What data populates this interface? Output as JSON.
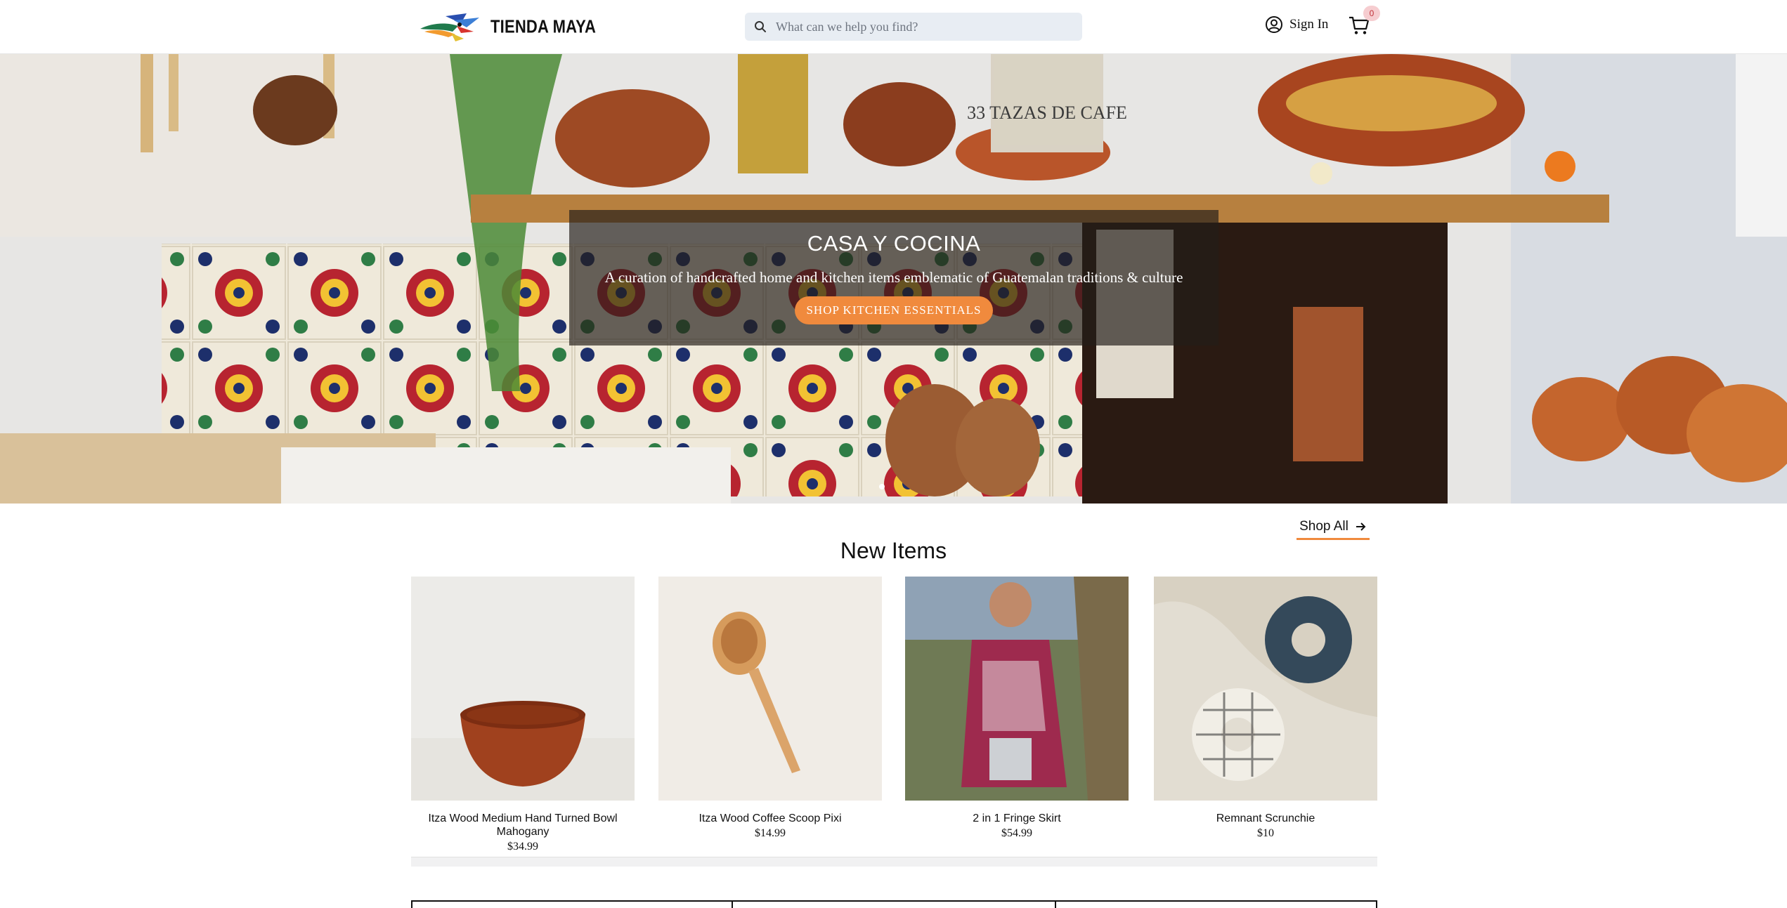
{
  "header": {
    "brand": "TIENDA MAYA",
    "search_placeholder": "What can we help you find?",
    "signin_label": "Sign In",
    "cart_count": "0"
  },
  "hero": {
    "title": "CASA Y COCINA",
    "subtitle": "A curation of handcrafted home and kitchen items emblematic of Guatemalan traditions & culture",
    "button_label": "SHOP KITCHEN ESSENTIALS",
    "slides": 1,
    "sign_text": "33 TAZAS DE CAFE"
  },
  "section": {
    "title": "New Items",
    "shop_all_label": "Shop All"
  },
  "products": [
    {
      "name": "Itza Wood Medium Hand Turned Bowl Mahogany",
      "price": "$34.99",
      "icon": "wood-bowl"
    },
    {
      "name": "Itza Wood Coffee Scoop Pixi",
      "price": "$14.99",
      "icon": "wood-scoop"
    },
    {
      "name": "2 in 1 Fringe Skirt",
      "price": "$54.99",
      "icon": "fringe-skirt"
    },
    {
      "name": "Remnant Scrunchie",
      "price": "$10",
      "icon": "scrunchies"
    }
  ],
  "colors": {
    "accent": "#f08a3d",
    "search_bg": "#e8edf3",
    "badge_bg": "#f6cdd0",
    "overlay": "rgba(35,30,25,0.68)"
  }
}
